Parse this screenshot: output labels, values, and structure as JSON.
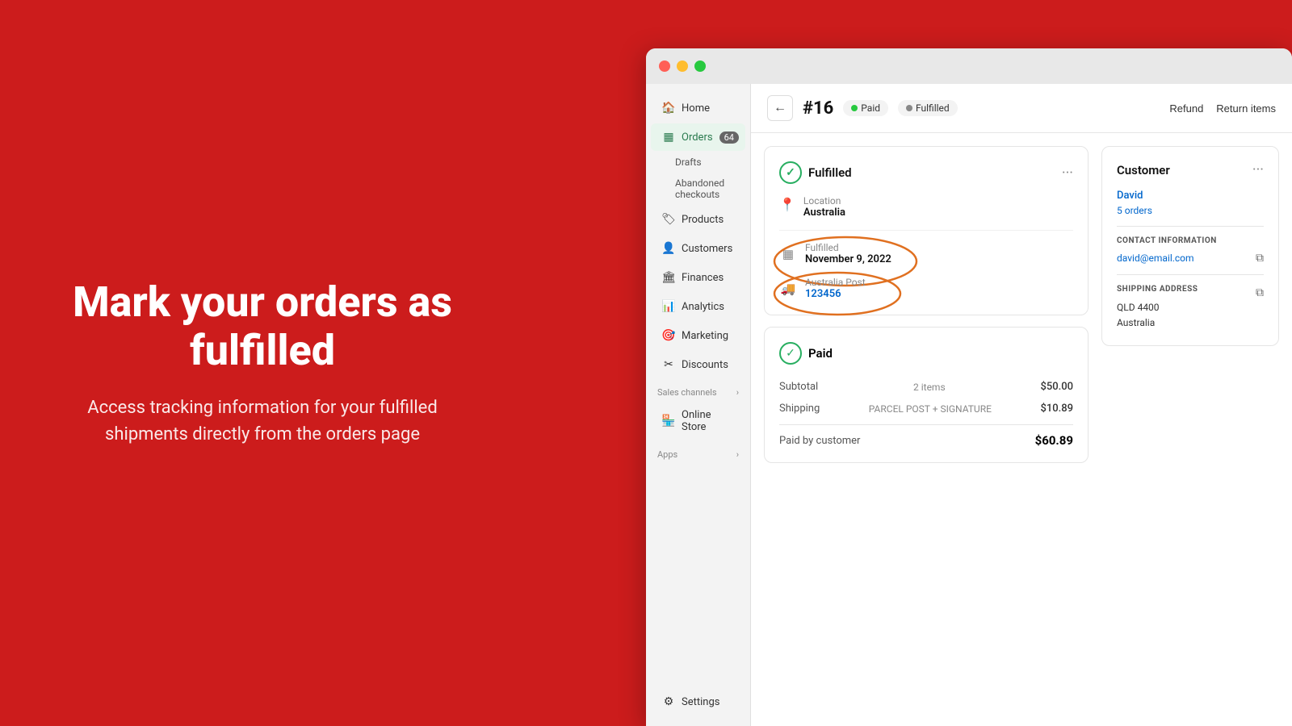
{
  "background_color": "#cc1c1c",
  "left_panel": {
    "heading": "Mark your orders as fulfilled",
    "subtext": "Access tracking information for your fulfilled shipments directly from the orders page"
  },
  "browser": {
    "titlebar": {
      "btn_close": "close",
      "btn_minimize": "minimize",
      "btn_maximize": "maximize"
    },
    "sidebar": {
      "items": [
        {
          "id": "home",
          "label": "Home",
          "icon": "🏠",
          "active": false
        },
        {
          "id": "orders",
          "label": "Orders",
          "icon": "📋",
          "active": true,
          "badge": "64"
        },
        {
          "id": "drafts",
          "label": "Drafts",
          "icon": "",
          "active": false,
          "sub": true
        },
        {
          "id": "abandoned",
          "label": "Abandoned checkouts",
          "icon": "",
          "active": false,
          "sub": true
        },
        {
          "id": "products",
          "label": "Products",
          "icon": "🏷️",
          "active": false
        },
        {
          "id": "customers",
          "label": "Customers",
          "icon": "👤",
          "active": false
        },
        {
          "id": "finances",
          "label": "Finances",
          "icon": "🏛️",
          "active": false
        },
        {
          "id": "analytics",
          "label": "Analytics",
          "icon": "📊",
          "active": false
        },
        {
          "id": "marketing",
          "label": "Marketing",
          "icon": "🎯",
          "active": false
        },
        {
          "id": "discounts",
          "label": "Discounts",
          "icon": "🏷️",
          "active": false
        }
      ],
      "sales_channels_label": "Sales channels",
      "online_store_label": "Online Store",
      "apps_label": "Apps",
      "settings_label": "Settings"
    },
    "header": {
      "back_label": "←",
      "order_number": "#16",
      "status_paid": "Paid",
      "status_fulfilled": "Fulfilled",
      "refund_label": "Refund",
      "return_items_label": "Return items"
    },
    "fulfilled_card": {
      "title": "Fulfilled",
      "menu_icon": "···",
      "location_label": "Location",
      "location_value": "Australia",
      "fulfillment_label": "Fulfilled",
      "fulfillment_date": "November 9, 2022",
      "carrier": "Australia Post",
      "tracking_number": "123456"
    },
    "paid_card": {
      "title": "Paid",
      "subtotal_label": "Subtotal",
      "subtotal_items": "2 items",
      "subtotal_amount": "$50.00",
      "shipping_label": "Shipping",
      "shipping_method": "PARCEL POST + SIGNATURE",
      "shipping_amount": "$10.89",
      "paid_by_label": "Paid by customer",
      "paid_total": "$60.89"
    },
    "customer_card": {
      "title": "Customer",
      "customer_name": "David",
      "customer_orders": "5 orders",
      "contact_title": "CONTACT INFORMATION",
      "email": "david@email.com",
      "shipping_title": "SHIPPING ADDRESS",
      "address_line1": "QLD 4400",
      "address_line2": "Australia"
    }
  }
}
